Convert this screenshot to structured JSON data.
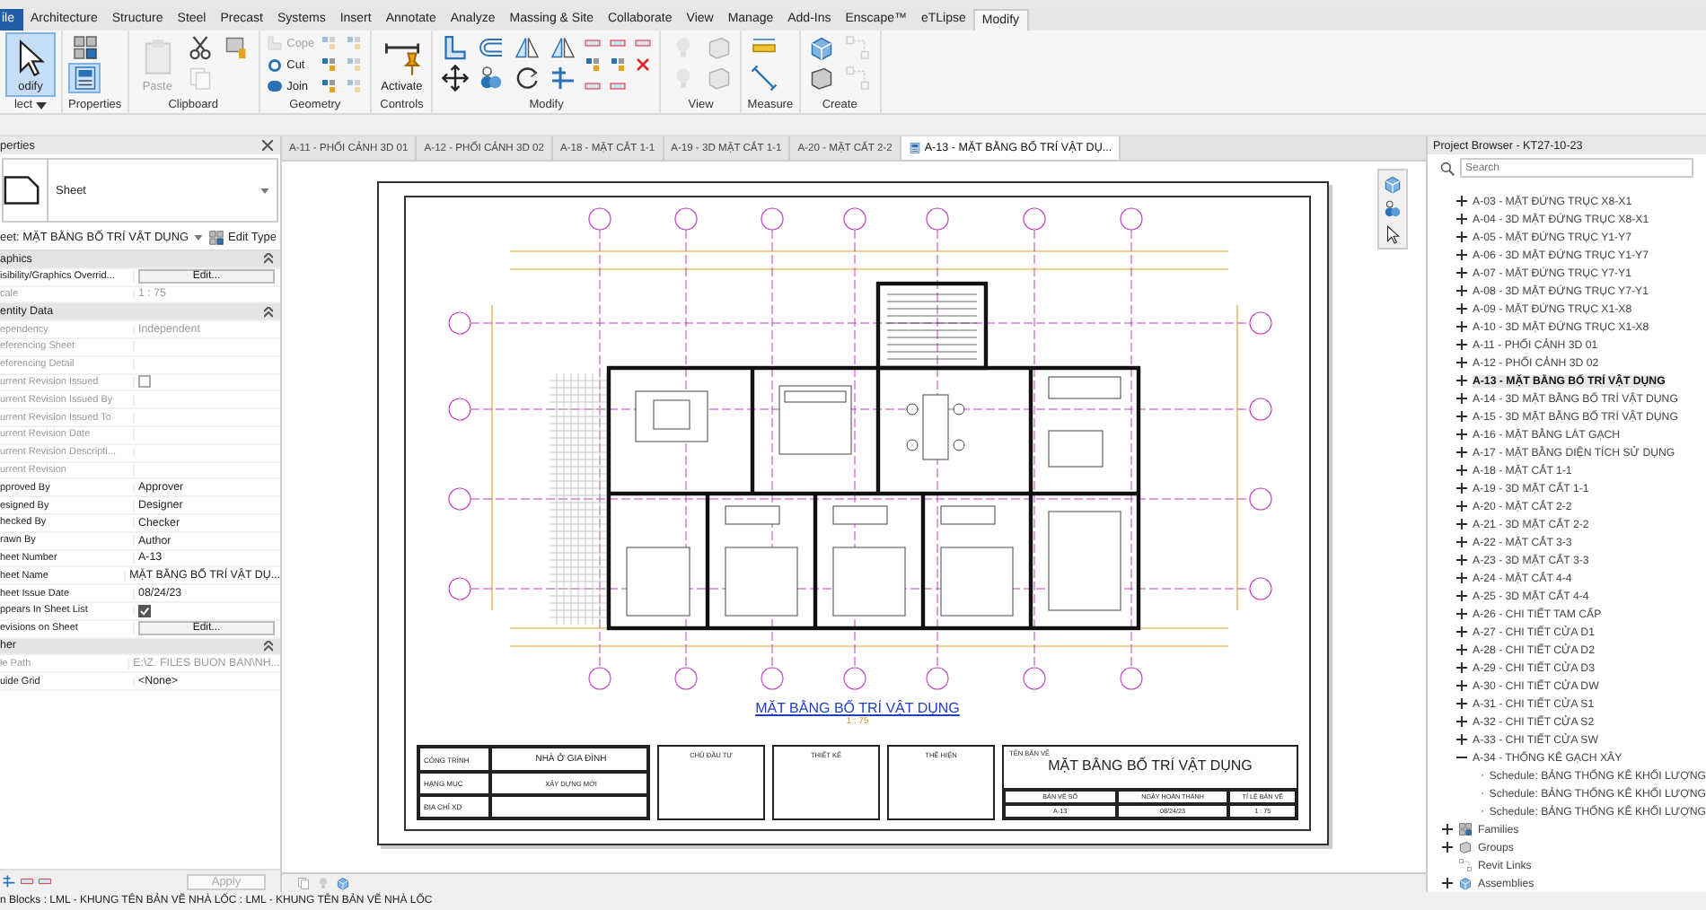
{
  "ribbon": {
    "tabs": [
      {
        "label": "ile",
        "kind": "file",
        "selected": false
      },
      {
        "label": "Architecture",
        "kind": "tab",
        "selected": false
      },
      {
        "label": "Structure",
        "kind": "tab",
        "selected": false
      },
      {
        "label": "Steel",
        "kind": "tab",
        "selected": false
      },
      {
        "label": "Precast",
        "kind": "tab",
        "selected": false
      },
      {
        "label": "Systems",
        "kind": "tab",
        "selected": false
      },
      {
        "label": "Insert",
        "kind": "tab",
        "selected": false
      },
      {
        "label": "Annotate",
        "kind": "tab",
        "selected": false
      },
      {
        "label": "Analyze",
        "kind": "tab",
        "selected": false
      },
      {
        "label": "Massing & Site",
        "kind": "tab",
        "selected": false
      },
      {
        "label": "Collaborate",
        "kind": "tab",
        "selected": false
      },
      {
        "label": "View",
        "kind": "tab",
        "selected": false
      },
      {
        "label": "Manage",
        "kind": "tab",
        "selected": false
      },
      {
        "label": "Add-Ins",
        "kind": "tab",
        "selected": false
      },
      {
        "label": "Enscape™",
        "kind": "tab",
        "selected": false
      },
      {
        "label": "eTLipse",
        "kind": "tab",
        "selected": false
      },
      {
        "label": "Modify",
        "kind": "tab",
        "selected": true
      }
    ],
    "panels": [
      {
        "label": "lect",
        "tools": [
          {
            "label": "odify",
            "disabled": false,
            "selected": true
          }
        ]
      },
      {
        "label": "Properties",
        "tools": [
          {
            "disabled": false,
            "selected": false
          },
          {
            "disabled": false,
            "selected": true
          }
        ]
      },
      {
        "label": "Clipboard",
        "tools": [
          {
            "label": "Paste",
            "disabled": true,
            "selected": false
          },
          {
            "disabled": false,
            "selected": false
          },
          {
            "disabled": true,
            "selected": false
          },
          {
            "disabled": false,
            "selected": false
          }
        ]
      },
      {
        "label": "Geometry",
        "tools": [
          {
            "label": "Cope",
            "disabled": true,
            "selected": false
          },
          {
            "label": "Cut",
            "disabled": false,
            "selected": false
          },
          {
            "label": "Join",
            "disabled": false,
            "selected": false
          },
          {
            "disabled": true,
            "selected": false
          },
          {
            "disabled": false,
            "selected": false
          },
          {
            "disabled": false,
            "selected": false
          },
          {
            "disabled": true,
            "selected": false
          },
          {
            "disabled": true,
            "selected": false
          },
          {
            "disabled": true,
            "selected": false
          }
        ]
      },
      {
        "label": "Controls",
        "tools": [
          {
            "label": "Activate",
            "disabled": false,
            "selected": false
          }
        ]
      },
      {
        "label": "Modify",
        "tools": [
          {
            "disabled": false,
            "selected": false
          },
          {
            "disabled": false,
            "selected": false
          },
          {
            "disabled": false,
            "selected": false
          },
          {
            "disabled": false,
            "selected": false
          },
          {
            "disabled": false,
            "selected": false
          },
          {
            "disabled": false,
            "selected": false
          },
          {
            "disabled": false,
            "selected": false
          },
          {
            "disabled": false,
            "selected": false
          },
          {
            "disabled": false,
            "selected": false
          },
          {
            "disabled": false,
            "selected": false
          },
          {
            "disabled": false,
            "selected": false
          },
          {
            "disabled": false,
            "selected": false
          },
          {
            "disabled": false,
            "selected": false
          },
          {
            "disabled": false,
            "selected": false
          },
          {
            "disabled": false,
            "selected": false
          },
          {
            "disabled": false,
            "selected": false
          }
        ]
      },
      {
        "label": "View",
        "tools": [
          {
            "disabled": true,
            "selected": false
          },
          {
            "disabled": true,
            "selected": false
          },
          {
            "disabled": true,
            "selected": false
          },
          {
            "disabled": true,
            "selected": false
          }
        ]
      },
      {
        "label": "Measure",
        "tools": [
          {
            "disabled": false,
            "selected": false
          },
          {
            "disabled": false,
            "selected": false
          }
        ]
      },
      {
        "label": "Create",
        "tools": [
          {
            "disabled": false,
            "selected": false
          },
          {
            "disabled": false,
            "selected": false
          },
          {
            "disabled": true,
            "selected": false
          },
          {
            "disabled": true,
            "selected": false
          }
        ]
      }
    ]
  },
  "properties": {
    "title": "perties",
    "type": "Sheet",
    "instance": "eet: MẶT BẰNG BỐ TRÍ VẬT DỤNG",
    "edit_type": "Edit Type",
    "groups": [
      {
        "label": "aphics",
        "rows": [
          {
            "label": "isibility/Graphics Overrid...",
            "value": "Edit...",
            "kind": "button",
            "disabled": false
          },
          {
            "label": "cale",
            "value": "1 : 75",
            "kind": "text",
            "disabled": true
          }
        ]
      },
      {
        "label": "entity Data",
        "rows": [
          {
            "label": "ependency",
            "value": "Independent",
            "kind": "text",
            "disabled": true
          },
          {
            "label": "eferencing Sheet",
            "kind": "text",
            "disabled": true
          },
          {
            "label": "eferencing Detail",
            "kind": "text",
            "disabled": true
          },
          {
            "label": "urrent Revision Issued",
            "kind": "checkbox",
            "checked": false,
            "disabled": true
          },
          {
            "label": "urrent Revision Issued By",
            "kind": "text",
            "disabled": true
          },
          {
            "label": "urrent Revision Issued To",
            "kind": "text",
            "disabled": true
          },
          {
            "label": "urrent Revision Date",
            "kind": "text",
            "disabled": true
          },
          {
            "label": "urrent Revision Descripti...",
            "kind": "text",
            "disabled": true
          },
          {
            "label": "urrent Revision",
            "kind": "text",
            "disabled": true
          },
          {
            "label": "pproved By",
            "value": "Approver",
            "kind": "text",
            "disabled": false
          },
          {
            "label": "esigned By",
            "value": "Designer",
            "kind": "text",
            "disabled": false
          },
          {
            "label": "hecked By",
            "value": "Checker",
            "kind": "text",
            "disabled": false
          },
          {
            "label": "rawn By",
            "value": "Author",
            "kind": "text",
            "disabled": false
          },
          {
            "label": "heet Number",
            "value": "A-13",
            "kind": "text",
            "disabled": false
          },
          {
            "label": "heet Name",
            "value": "MẶT BẰNG BỐ TRÍ VẬT DỤ...",
            "kind": "text",
            "disabled": false
          },
          {
            "label": "heet Issue Date",
            "value": "08/24/23",
            "kind": "text",
            "disabled": false
          },
          {
            "label": "ppears In Sheet List",
            "kind": "checkbox",
            "checked": true,
            "disabled": false
          },
          {
            "label": "evisions on Sheet",
            "value": "Edit...",
            "kind": "button",
            "disabled": false
          }
        ]
      },
      {
        "label": "her",
        "rows": [
          {
            "label": "le Path",
            "value": "E:\\Z. FILES BUON BAN\\NH...",
            "kind": "text",
            "disabled": true
          },
          {
            "label": "uide Grid",
            "value": "<None>",
            "kind": "text",
            "disabled": false
          }
        ]
      }
    ],
    "apply": {
      "label": "Apply",
      "disabled": true
    }
  },
  "doc_tabs": [
    {
      "label": "A-11 - PHỐI CẢNH 3D 01",
      "selected": false
    },
    {
      "label": "A-12 - PHỐI CẢNH 3D 02",
      "selected": false
    },
    {
      "label": "A-18 - MẶT CẮT 1-1",
      "selected": false
    },
    {
      "label": "A-19 - 3D MẶT CẮT 1-1",
      "selected": false
    },
    {
      "label": "A-20 - MẶT CẮT 2-2",
      "selected": false
    },
    {
      "label": "A-13 - MẶT BẰNG BỐ TRÍ VẬT DỤ...",
      "selected": true
    }
  ],
  "sheet": {
    "title": "MẶT BẰNG BỐ TRÍ VẬT DỤNG",
    "scale": "1 : 75",
    "title_block": {
      "project_label": "CÔNG TRÌNH",
      "project": "NHÀ Ở GIA ĐÌNH",
      "category_label": "HẠNG MỤC",
      "category": "XÂY DỰNG MỚI",
      "address_label": "ĐỊA CHỈ XD",
      "owner_label": "CHỦ ĐẦU TƯ",
      "designer_label": "THIẾT KẾ",
      "drafter_label": "THỂ HIỆN",
      "sheet_name_label": "TÊN BẢN VẼ",
      "sheet_name": "MẶT BẰNG BỐ TRÍ VẬT DỤNG",
      "sheet_number_label": "BẢN VẼ SỐ",
      "sheet_number": "A-13",
      "date_label": "NGÀY HOÀN THÀNH",
      "date": "08/24/23",
      "scale_label": "TỈ LỆ BẢN VẼ",
      "scale": "1 : 75"
    }
  },
  "browser": {
    "title": "Project Browser - KT27-10-23",
    "search": {
      "placeholder": "Search"
    },
    "sheets": [
      {
        "label": "A-03 - MẶT ĐỨNG TRỤC X8-X1",
        "expanded": false,
        "selected": false
      },
      {
        "label": "A-04 - 3D MẶT ĐỨNG TRỤC X8-X1",
        "expanded": false,
        "selected": false
      },
      {
        "label": "A-05 - MẶT ĐỨNG TRỤC Y1-Y7",
        "expanded": false,
        "selected": false
      },
      {
        "label": "A-06 - 3D MẶT ĐỨNG TRỤC Y1-Y7",
        "expanded": false,
        "selected": false
      },
      {
        "label": "A-07 - MẶT ĐỨNG TRỤC Y7-Y1",
        "expanded": false,
        "selected": false
      },
      {
        "label": "A-08 - 3D MẶT ĐỨNG TRỤC Y7-Y1",
        "expanded": false,
        "selected": false
      },
      {
        "label": "A-09 - MẶT ĐỨNG TRỤC X1-X8",
        "expanded": false,
        "selected": false
      },
      {
        "label": "A-10 - 3D MẶT ĐỨNG TRỤC X1-X8",
        "expanded": false,
        "selected": false
      },
      {
        "label": "A-11 - PHỐI CẢNH 3D 01",
        "expanded": false,
        "selected": false
      },
      {
        "label": "A-12 - PHỐI CẢNH 3D 02",
        "expanded": false,
        "selected": false
      },
      {
        "label": "A-13 - MẶT BẰNG BỐ TRÍ VẬT DỤNG",
        "expanded": false,
        "selected": true
      },
      {
        "label": "A-14 - 3D MẶT BẰNG BỐ TRÍ VẬT DỤNG",
        "expanded": false,
        "selected": false
      },
      {
        "label": "A-15 - 3D MẶT BẰNG BỐ TRÍ VẬT DỤNG",
        "expanded": false,
        "selected": false
      },
      {
        "label": "A-16 - MẶT BẰNG LÁT GẠCH",
        "expanded": false,
        "selected": false
      },
      {
        "label": "A-17 - MẶT BẰNG DIỆN TÍCH SỬ DỤNG",
        "expanded": false,
        "selected": false
      },
      {
        "label": "A-18 - MẶT CẮT 1-1",
        "expanded": false,
        "selected": false
      },
      {
        "label": "A-19 - 3D MẶT CẮT 1-1",
        "expanded": false,
        "selected": false
      },
      {
        "label": "A-20 - MẶT CẮT 2-2",
        "expanded": false,
        "selected": false
      },
      {
        "label": "A-21 - 3D MẶT CẮT 2-2",
        "expanded": false,
        "selected": false
      },
      {
        "label": "A-22 - MẶT CẮT 3-3",
        "expanded": false,
        "selected": false
      },
      {
        "label": "A-23 - 3D MẶT CẮT 3-3",
        "expanded": false,
        "selected": false
      },
      {
        "label": "A-24 - MẶT CẮT 4-4",
        "expanded": false,
        "selected": false
      },
      {
        "label": "A-25 - 3D MẶT CẮT 4-4",
        "expanded": false,
        "selected": false
      },
      {
        "label": "A-26 - CHI TIẾT TAM CẤP",
        "expanded": false,
        "selected": false
      },
      {
        "label": "A-27 - CHI TIẾT CỬA D1",
        "expanded": false,
        "selected": false
      },
      {
        "label": "A-28 - CHI TIẾT CỬA D2",
        "expanded": false,
        "selected": false
      },
      {
        "label": "A-29 - CHI TIẾT CỬA D3",
        "expanded": false,
        "selected": false
      },
      {
        "label": "A-30 - CHI TIẾT CỬA DW",
        "expanded": false,
        "selected": false
      },
      {
        "label": "A-31 - CHI TIẾT CỬA S1",
        "expanded": false,
        "selected": false
      },
      {
        "label": "A-32 - CHI TIẾT CỬA S2",
        "expanded": false,
        "selected": false
      },
      {
        "label": "A-33 - CHI TIẾT CỬA SW",
        "expanded": false,
        "selected": false
      },
      {
        "label": "A-34 - THỐNG KÊ GẠCH XÂY",
        "expanded": true,
        "selected": false,
        "children": [
          {
            "label": "Schedule: BẢNG THỐNG KÊ KHỐI LƯỢNG",
            "selected": false
          },
          {
            "label": "Schedule: BẢNG THỐNG KÊ KHỐI LƯỢNG",
            "selected": false
          },
          {
            "label": "Schedule: BẢNG THỐNG KÊ KHỐI LƯỢNG",
            "selected": false
          }
        ]
      }
    ],
    "roots": [
      {
        "label": "Families",
        "kind": "families",
        "expanded": false
      },
      {
        "label": "Groups",
        "kind": "groups",
        "expanded": false
      },
      {
        "label": "Revit Links",
        "kind": "links"
      },
      {
        "label": "Assemblies",
        "kind": "assemblies",
        "expanded": false
      }
    ]
  },
  "status_bar": {
    "text": "n Blocks : LML - KHUNG TÊN BẢN VẼ NHÀ LỐC : LML - KHUNG TÊN BẢN VẼ NHÀ LỐC"
  }
}
